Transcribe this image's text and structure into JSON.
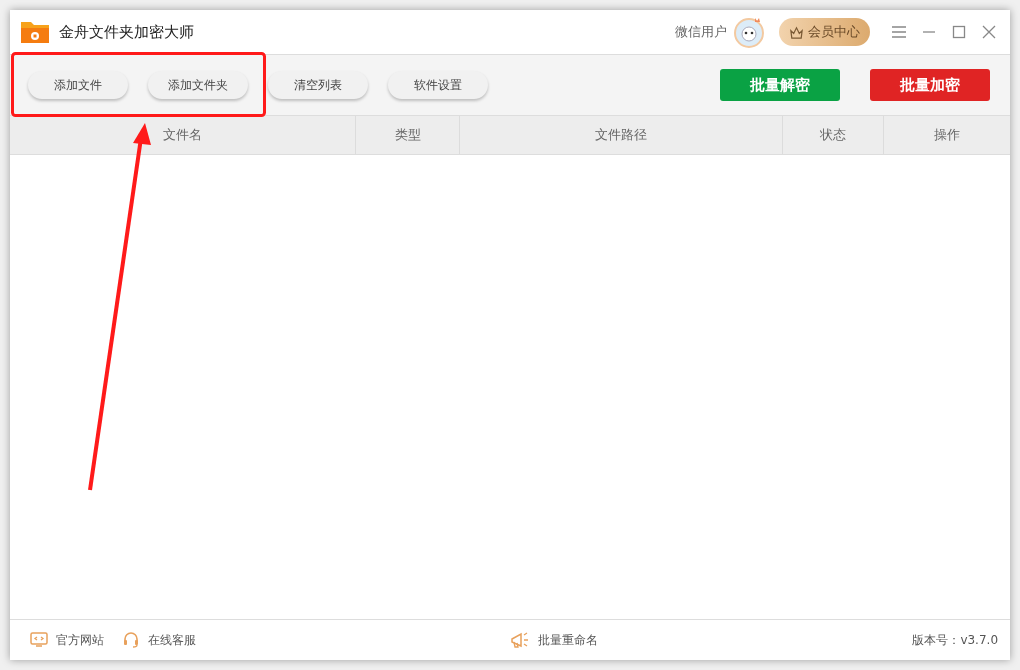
{
  "window": {
    "title": "金舟文件夹加密大师"
  },
  "user": {
    "name": "微信用户"
  },
  "member_button": "会员中心",
  "toolbar": {
    "left_buttons": [
      "添加文件",
      "添加文件夹",
      "清空列表",
      "软件设置"
    ],
    "right_buttons": [
      {
        "label": "批量解密",
        "kind": "decrypt"
      },
      {
        "label": "批量加密",
        "kind": "encrypt"
      }
    ]
  },
  "table": {
    "columns": [
      "文件名",
      "类型",
      "文件路径",
      "状态",
      "操作"
    ]
  },
  "status_bar": {
    "links": [
      {
        "label": "官方网站",
        "kind": "website"
      },
      {
        "label": "在线客服",
        "kind": "support"
      }
    ],
    "center": "批量重命名",
    "version": "版本号：v3.7.0"
  }
}
